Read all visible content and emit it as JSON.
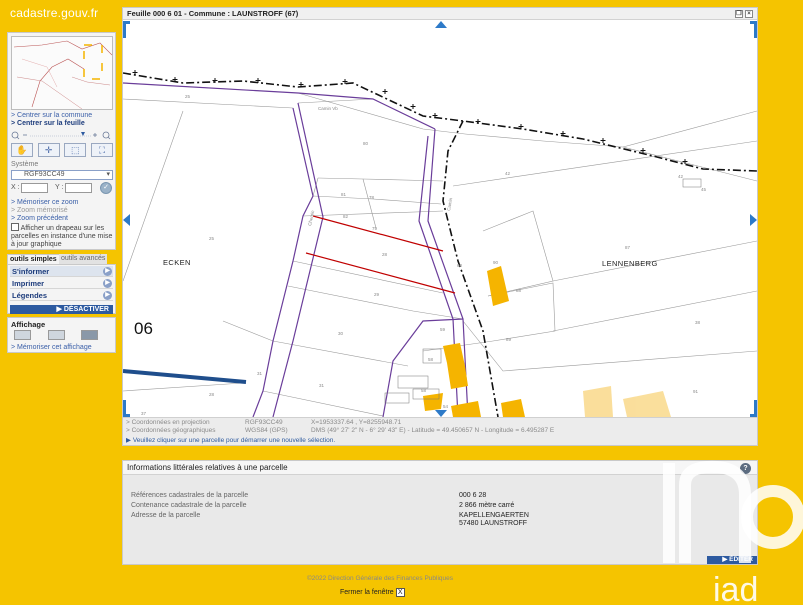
{
  "logo": "cadastre.gouv.fr",
  "nav": {
    "centrer_commune": "> Centrer sur la commune",
    "centrer_feuille": "> Centrer sur la feuille"
  },
  "systeme": {
    "label": "Système",
    "selected": "RGF93CC49",
    "x_label": "X :",
    "y_label": "Y :",
    "ok": "✓"
  },
  "zoom_links": {
    "memoriser": "> Mémoriser ce zoom",
    "memorise": "> Zoom mémorisé",
    "precedent": "> Zoom précédent"
  },
  "checkbox": {
    "label": "Afficher un drapeau sur les parcelles en instance d'une mise à jour graphique",
    "checked": false
  },
  "tabs": {
    "active": "outils simples",
    "inactive": "outils avancés"
  },
  "tools": {
    "sinformer": "S'informer",
    "imprimer": "Imprimer",
    "legendes": "Légendes",
    "desactiver": "DÉSACTIVER"
  },
  "affichage": {
    "title": "Affichage",
    "memoriser": "> Mémoriser cet affichage"
  },
  "map": {
    "title": "Feuille 000 6 01 - Commune : LAUNSTROFF (67)",
    "labels": {
      "ecken": "ECKEN",
      "lennenberg": "LENNENBERG",
      "sheet": "06"
    }
  },
  "coords": {
    "projection_label": "> Coordonnées en projection",
    "projection_system": "RGF93CC49",
    "projection_value": "X=1953337.64 , Y=8255948.71",
    "geo_label": "> Coordonnées géographiques",
    "geo_system": "WGS84 (GPS)",
    "geo_value": "DMS (49° 27' 2\" N - 6° 29' 43\" E) - Latitude = 49.450657 N - Longitude = 6.495287 E",
    "message": "Veuillez cliquer sur une parcelle pour démarrer une nouvelle sélection."
  },
  "info": {
    "title": "Informations littérales relatives à une parcelle",
    "help": "?",
    "rows": [
      {
        "label": "Références cadastrales de la parcelle",
        "value": "000 6 28"
      },
      {
        "label": "Contenance cadastrale de la parcelle",
        "value": "2 866 mètre carré"
      },
      {
        "label": "Adresse de la parcelle",
        "value": "KAPELLENGAERTEN"
      },
      {
        "label": "",
        "value": "57480 LAUNSTROFF"
      }
    ],
    "editer": "ÉDITER"
  },
  "footer": {
    "copyright": "©2022 Direction Générale des Finances Publiques",
    "close": "Fermer la fenêtre",
    "close_x": "X"
  },
  "watermark": "iad",
  "colors": {
    "background": "#f5c400",
    "link": "#3a5fa8",
    "accent": "#2d5aa0",
    "parcel_border_purple": "#6a3d9a",
    "selected_parcel_red": "#c00000",
    "building_orange": "#f5b400",
    "road_blue": "#1f4e8c"
  }
}
